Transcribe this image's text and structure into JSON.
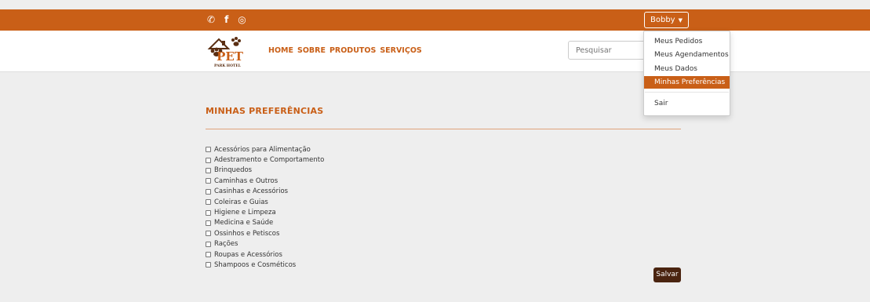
{
  "topbar": {
    "social": [
      {
        "icon": "whatsapp-icon",
        "glyph": "✆"
      },
      {
        "icon": "facebook-icon",
        "glyph": "f"
      },
      {
        "icon": "instagram-icon",
        "glyph": "◎"
      }
    ],
    "user_name": "Bobby",
    "caret": "▼"
  },
  "brand": {
    "logo_text": "PET",
    "logo_subtext": "PARK HOTEL"
  },
  "nav": {
    "links": [
      "HOME",
      "SOBRE",
      "PRODUTOS",
      "SERVIÇOS"
    ]
  },
  "search": {
    "placeholder": "Pesquisar"
  },
  "user_menu": {
    "items": [
      "Meus Pedidos",
      "Meus Agendamentos",
      "Meus Dados",
      "Minhas Preferências",
      "Sair"
    ],
    "active": "Minhas Preferências"
  },
  "main": {
    "title": "MINHAS PREFERÊNCIAS",
    "preferences": [
      "Acessórios para Alimentação",
      "Adestramento e Comportamento",
      "Brinquedos",
      "Caminhas e Outros",
      "Casinhas e Acessórios",
      "Coleiras e Guias",
      "Higiene e Limpeza",
      "Medicina e Saúde",
      "Ossinhos e Petiscos",
      "Rações",
      "Roupas e Acessórios",
      "Shampoos e Cosméticos"
    ],
    "save_label": "Salvar"
  },
  "colors": {
    "brand": "#c95f17",
    "save_button": "#4a2410",
    "background": "#eeeeee"
  }
}
